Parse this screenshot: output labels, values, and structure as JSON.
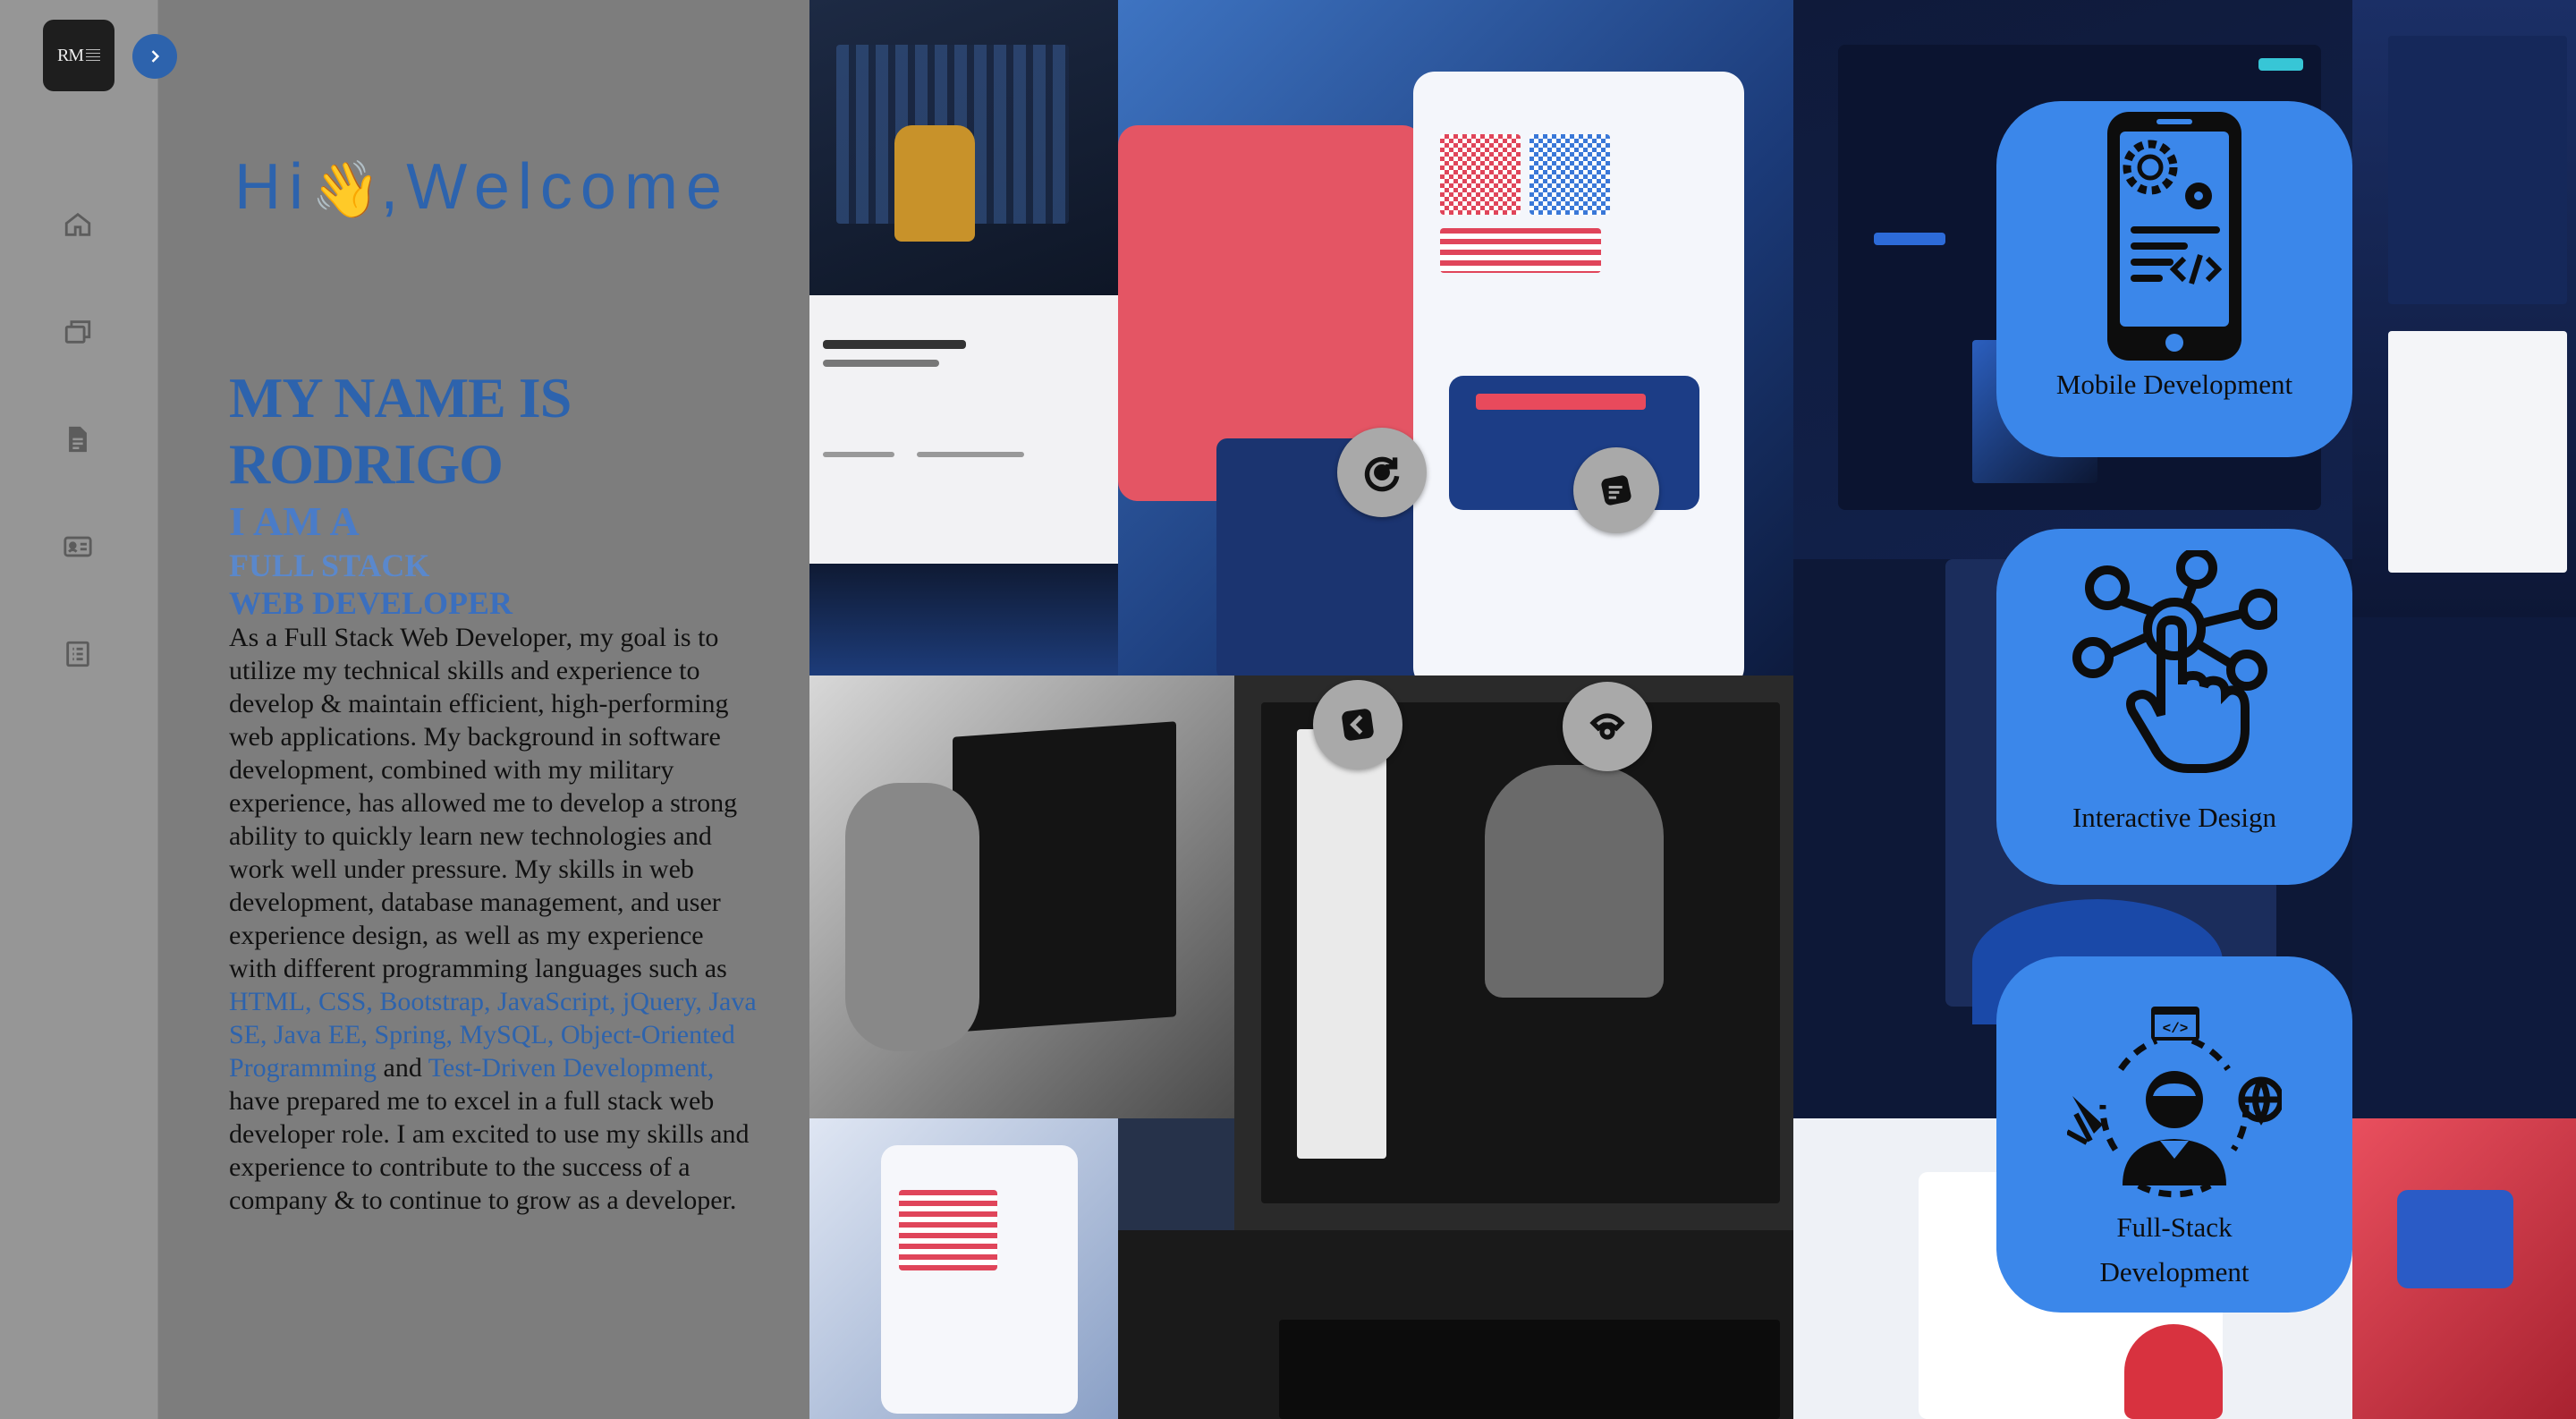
{
  "sidebar": {
    "logo_text": "RM",
    "expand_icon": "chevron-right-icon",
    "nav": [
      {
        "icon": "home-icon"
      },
      {
        "icon": "windows-icon"
      },
      {
        "icon": "document-icon"
      },
      {
        "icon": "id-card-icon"
      },
      {
        "icon": "list-icon"
      }
    ]
  },
  "intro": {
    "greeting": "Hi",
    "wave": "👋",
    "welcome": ",Welcome",
    "name_line1": "MY NAME IS",
    "name_line2": "RODRIGO",
    "role_line1": "I AM A",
    "role_line2": "FULL STACK",
    "role_line3": "WEB DEVELOPER",
    "bio_part1": "As a Full Stack Web Developer, my goal is to utilize my technical skills and experience to develop & maintain efficient, high-performing web applications. My background in software development, combined with my military experience, has allowed me to develop a strong ability to quickly learn new technologies and work well under pressure. My skills in web development, database management, and user experience design, as well as my experience with different programming languages such as ",
    "bio_skills": "HTML, CSS, Bootstrap, JavaScript, jQuery, Java SE, Java EE, Spring, MySQL, Object-Oriented Programming",
    "bio_and": " and ",
    "bio_tdd": "Test-Driven Development,",
    "bio_part2": " have prepared me to excel in a full stack web developer role. I am excited to use my skills and experience to contribute to the success of a company & to continue to grow as a developer."
  },
  "cards": [
    {
      "label": "Mobile Development",
      "icon": "mobile-development-icon"
    },
    {
      "label": "Interactive Design",
      "icon": "interactive-design-icon"
    },
    {
      "label": "Full-Stack Development",
      "icon": "full-stack-icon"
    }
  ],
  "colors": {
    "accent": "#2d63ad",
    "card": "#3b87ea",
    "sidebar": "#969696",
    "panel": "#7d7d7d"
  }
}
